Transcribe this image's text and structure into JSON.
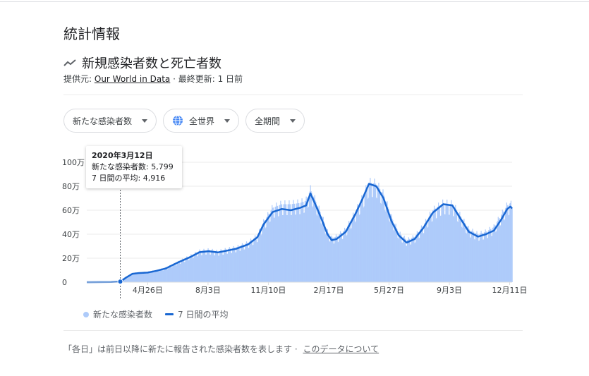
{
  "section_title": "統計情報",
  "chart_title": "新規感染者数と死亡者数",
  "source": {
    "prefix": "提供元:",
    "link": "Our World in Data",
    "updated": "· 最終更新: 1 日前"
  },
  "filters": [
    {
      "label": "新たな感染者数"
    },
    {
      "label": "全世界"
    },
    {
      "label": "全期間"
    }
  ],
  "tooltip": {
    "date": "2020年3月12日",
    "line1_label": "新たな感染者数:",
    "line1_value": "5,799",
    "line2_label": "7 日間の平均:",
    "line2_value": "4,916"
  },
  "legend": {
    "daily": "新たな感染者数",
    "avg": "7 日間の平均"
  },
  "footer": {
    "text": "「各日」は前日以降に新たに報告された感染者数を表します ·",
    "link": "このデータについて"
  },
  "colors": {
    "bars": "#aecbfa",
    "line": "#1967d2",
    "grid": "#ebebeb"
  },
  "chart_data": {
    "type": "area",
    "ylim": [
      0,
      1000000
    ],
    "y_ticks": [
      {
        "value": 0,
        "label": "0"
      },
      {
        "value": 200000,
        "label": "20万"
      },
      {
        "value": 400000,
        "label": "40万"
      },
      {
        "value": 600000,
        "label": "60万"
      },
      {
        "value": 800000,
        "label": "80万"
      },
      {
        "value": 1000000,
        "label": "100万"
      }
    ],
    "x_ticks": [
      {
        "day": 100,
        "label": "4月26日"
      },
      {
        "day": 199,
        "label": "8月3日"
      },
      {
        "day": 298,
        "label": "11月10日"
      },
      {
        "day": 397,
        "label": "2月17日"
      },
      {
        "day": 496,
        "label": "5月27日"
      },
      {
        "day": 595,
        "label": "9月3日"
      },
      {
        "day": 694,
        "label": "12月11日"
      }
    ],
    "x_range": [
      0,
      698
    ],
    "tooltip_day": 55,
    "series": [
      {
        "name": "新たな感染者数",
        "kind": "daily_bars",
        "points": [
          [
            0,
            0
          ],
          [
            40,
            2000
          ],
          [
            55,
            6000
          ],
          [
            65,
            40000
          ],
          [
            75,
            75000
          ],
          [
            85,
            80000
          ],
          [
            100,
            85000
          ],
          [
            115,
            100000
          ],
          [
            130,
            120000
          ],
          [
            150,
            170000
          ],
          [
            170,
            220000
          ],
          [
            185,
            260000
          ],
          [
            200,
            270000
          ],
          [
            215,
            255000
          ],
          [
            230,
            275000
          ],
          [
            245,
            290000
          ],
          [
            265,
            330000
          ],
          [
            280,
            390000
          ],
          [
            290,
            500000
          ],
          [
            305,
            620000
          ],
          [
            320,
            650000
          ],
          [
            335,
            650000
          ],
          [
            350,
            660000
          ],
          [
            360,
            680000
          ],
          [
            367,
            770000
          ],
          [
            375,
            680000
          ],
          [
            385,
            560000
          ],
          [
            395,
            420000
          ],
          [
            402,
            370000
          ],
          [
            410,
            380000
          ],
          [
            425,
            440000
          ],
          [
            440,
            580000
          ],
          [
            452,
            700000
          ],
          [
            463,
            830000
          ],
          [
            475,
            820000
          ],
          [
            487,
            730000
          ],
          [
            500,
            540000
          ],
          [
            512,
            410000
          ],
          [
            525,
            350000
          ],
          [
            538,
            380000
          ],
          [
            552,
            470000
          ],
          [
            568,
            600000
          ],
          [
            585,
            660000
          ],
          [
            600,
            650000
          ],
          [
            612,
            560000
          ],
          [
            627,
            440000
          ],
          [
            642,
            400000
          ],
          [
            655,
            420000
          ],
          [
            668,
            460000
          ],
          [
            680,
            560000
          ],
          [
            690,
            640000
          ],
          [
            695,
            660000
          ],
          [
            698,
            620000
          ]
        ]
      },
      {
        "name": "7 日間の平均",
        "kind": "line",
        "points": [
          [
            0,
            0
          ],
          [
            40,
            1000
          ],
          [
            55,
            4916
          ],
          [
            65,
            40000
          ],
          [
            75,
            70000
          ],
          [
            85,
            76000
          ],
          [
            100,
            80000
          ],
          [
            115,
            95000
          ],
          [
            130,
            115000
          ],
          [
            150,
            165000
          ],
          [
            170,
            210000
          ],
          [
            185,
            250000
          ],
          [
            200,
            258000
          ],
          [
            215,
            248000
          ],
          [
            230,
            263000
          ],
          [
            245,
            278000
          ],
          [
            265,
            315000
          ],
          [
            280,
            375000
          ],
          [
            290,
            480000
          ],
          [
            305,
            585000
          ],
          [
            320,
            610000
          ],
          [
            335,
            600000
          ],
          [
            350,
            620000
          ],
          [
            360,
            640000
          ],
          [
            367,
            740000
          ],
          [
            375,
            650000
          ],
          [
            385,
            530000
          ],
          [
            395,
            400000
          ],
          [
            402,
            350000
          ],
          [
            410,
            360000
          ],
          [
            425,
            420000
          ],
          [
            440,
            560000
          ],
          [
            452,
            690000
          ],
          [
            463,
            820000
          ],
          [
            475,
            800000
          ],
          [
            487,
            700000
          ],
          [
            500,
            510000
          ],
          [
            512,
            390000
          ],
          [
            525,
            330000
          ],
          [
            538,
            360000
          ],
          [
            552,
            450000
          ],
          [
            568,
            580000
          ],
          [
            585,
            650000
          ],
          [
            600,
            640000
          ],
          [
            612,
            540000
          ],
          [
            627,
            420000
          ],
          [
            642,
            380000
          ],
          [
            655,
            400000
          ],
          [
            668,
            430000
          ],
          [
            680,
            520000
          ],
          [
            690,
            610000
          ],
          [
            695,
            630000
          ],
          [
            698,
            615000
          ]
        ]
      }
    ]
  }
}
